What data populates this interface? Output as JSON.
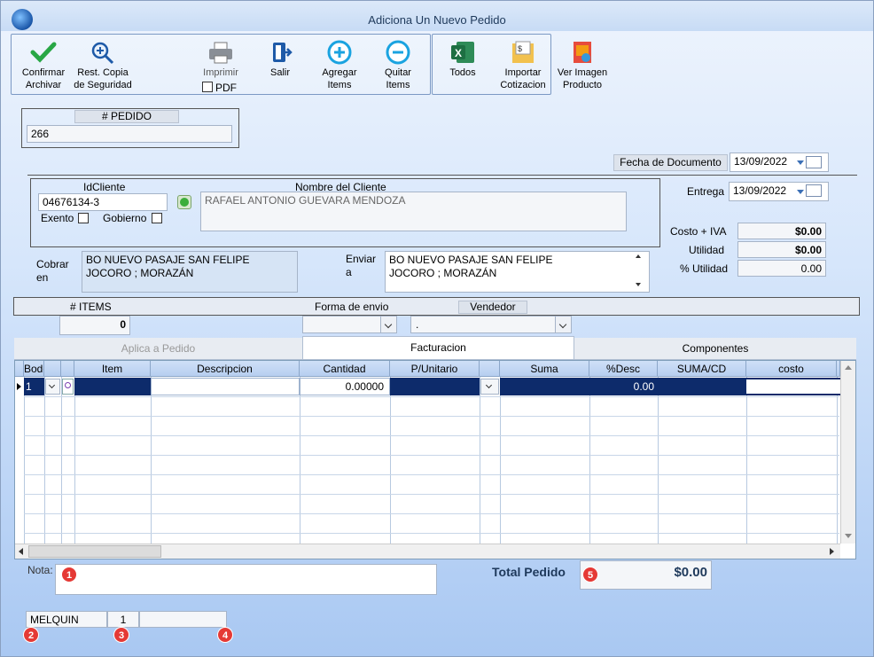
{
  "window": {
    "title": "Adiciona Un Nuevo Pedido"
  },
  "toolbar": {
    "confirm_line1": "Confirmar",
    "confirm_line2": "Archivar",
    "restore_line1": "Rest. Copia",
    "restore_line2": "de Seguridad",
    "print_label": "Imprimir",
    "pdf_label": "PDF",
    "exit_label": "Salir",
    "add_line1": "Agregar",
    "add_line2": "Items",
    "remove_line1": "Quitar",
    "remove_line2": "Items",
    "all_label": "Todos",
    "import_line1": "Importar",
    "import_line2": "Cotizacion",
    "image_line1": "Ver Imagen",
    "image_line2": "Producto"
  },
  "pedido": {
    "label": "# PEDIDO",
    "value": "266"
  },
  "fecha_documento": {
    "label": "Fecha de  Documento",
    "value": "13/09/2022"
  },
  "entrega": {
    "label": "Entrega",
    "value": "13/09/2022"
  },
  "cliente": {
    "id_label": "IdCliente",
    "id_value": "04676134-3",
    "name_label": "Nombre del Cliente",
    "name_value": "RAFAEL ANTONIO GUEVARA MENDOZA",
    "exento_label": "Exento",
    "gobierno_label": "Gobierno"
  },
  "summary": {
    "costo_label": "Costo + IVA",
    "costo_value": "$0.00",
    "utilidad_label": "Utilidad",
    "utilidad_value": "$0.00",
    "pct_label": "% Utilidad",
    "pct_value": "0.00"
  },
  "cobrar": {
    "label_line1": "Cobrar",
    "label_line2": "en",
    "line1": "BO NUEVO PASAJE SAN FELIPE",
    "line2": "JOCORO ; MORAZÁN"
  },
  "enviar": {
    "label_line1": "Enviar",
    "label_line2": "a",
    "line1": "BO NUEVO PASAJE SAN FELIPE",
    "line2": "JOCORO ; MORAZÁN"
  },
  "bar": {
    "items_label": "# ITEMS",
    "items_value": "0",
    "forma_label": "Forma de envio",
    "vendedor_label": "Vendedor",
    "vendedor_value": "."
  },
  "tabs": {
    "aplica": "Aplica a Pedido",
    "facturacion": "Facturacion",
    "componentes": "Componentes"
  },
  "grid": {
    "headers": [
      "Bodega",
      "",
      "Item",
      "Descripcion",
      "Cantidad",
      "P/Unitario",
      "",
      "Suma",
      "%Desc",
      "SUMA/CD",
      "costo"
    ],
    "row1": {
      "bodega": "1",
      "cantidad": "0.00000",
      "desc": "0.00"
    }
  },
  "nota": {
    "label": "Nota:"
  },
  "total": {
    "label": "Total Pedido",
    "value": "$0.00"
  },
  "status": {
    "user": "MELQUIN",
    "number": "1"
  },
  "markers": [
    "1",
    "2",
    "3",
    "4",
    "5"
  ],
  "colors": {
    "accent": "#0d2b6b",
    "marker": "#e53935"
  }
}
